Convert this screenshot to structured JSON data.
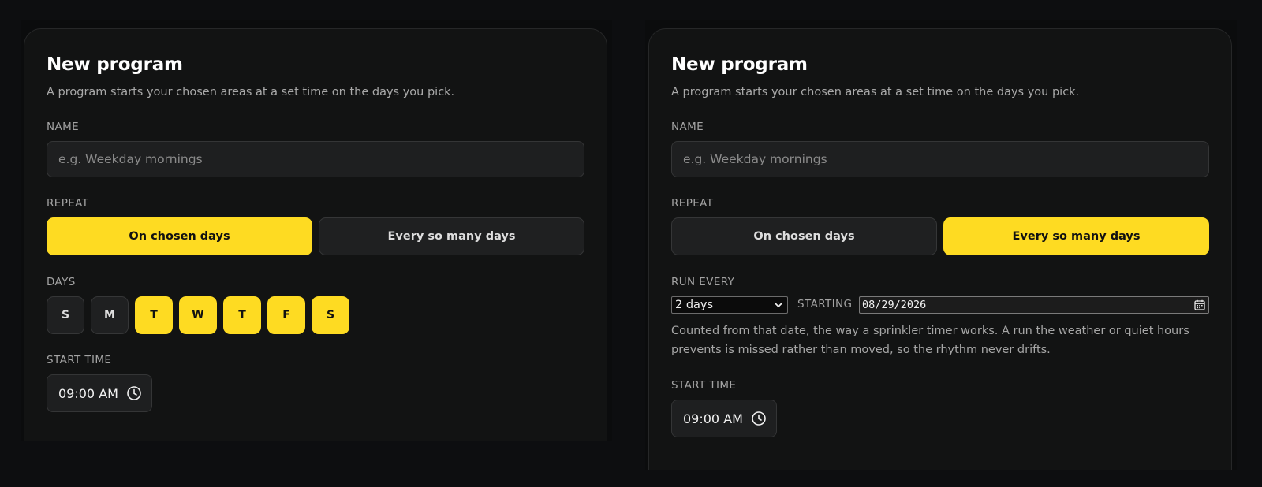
{
  "left": {
    "title": "New program",
    "subtitle": "A program starts your chosen areas at a set time on the days you pick.",
    "name_label": "NAME",
    "name_placeholder": "e.g. Weekday mornings",
    "repeat_label": "REPEAT",
    "repeat_options": [
      "On chosen days",
      "Every so many days"
    ],
    "repeat_selected": "On chosen days",
    "days_label": "DAYS",
    "days": [
      {
        "letter": "S",
        "selected": false
      },
      {
        "letter": "M",
        "selected": false
      },
      {
        "letter": "T",
        "selected": true
      },
      {
        "letter": "W",
        "selected": true
      },
      {
        "letter": "T",
        "selected": true
      },
      {
        "letter": "F",
        "selected": true
      },
      {
        "letter": "S",
        "selected": true
      }
    ],
    "start_time_label": "START TIME",
    "start_time": "09:00 AM"
  },
  "right": {
    "title": "New program",
    "subtitle": "A program starts your chosen areas at a set time on the days you pick.",
    "name_label": "NAME",
    "name_placeholder": "e.g. Weekday mornings",
    "repeat_label": "REPEAT",
    "repeat_options": [
      "On chosen days",
      "Every so many days"
    ],
    "repeat_selected": "Every so many days",
    "run_every_label": "RUN EVERY",
    "run_every_value": "2 days",
    "starting_label": "STARTING",
    "starting_date": "08/29/2026",
    "help_text": "Counted from that date, the way a sprinkler timer works. A run the weather or quiet hours prevents is missed rather than moved, so the rhythm never drifts.",
    "start_time_label": "START TIME",
    "start_time": "09:00 AM"
  },
  "colors": {
    "accent": "#fedb22",
    "card": "#121313",
    "background": "#0d0e10"
  },
  "icons": [
    "clock-icon",
    "chevron-down-icon",
    "calendar-icon"
  ]
}
